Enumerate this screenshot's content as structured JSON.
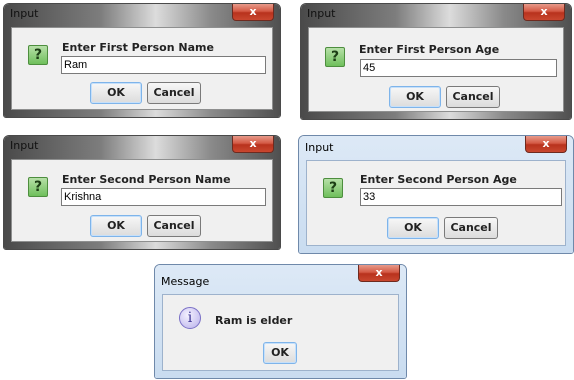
{
  "dialogs": [
    {
      "title": "Input",
      "close": "x",
      "prompt": "Enter First Person Name",
      "value": "Ram",
      "ok": "OK",
      "cancel": "Cancel"
    },
    {
      "title": "Input",
      "close": "x",
      "prompt": "Enter First Person Age",
      "value": "45",
      "ok": "OK",
      "cancel": "Cancel"
    },
    {
      "title": "Input",
      "close": "x",
      "prompt": "Enter Second Person Name",
      "value": "Krishna",
      "ok": "OK",
      "cancel": "Cancel"
    },
    {
      "title": "Input",
      "close": "x",
      "prompt": "Enter Second Person Age",
      "value": "33",
      "ok": "OK",
      "cancel": "Cancel"
    }
  ],
  "message": {
    "title": "Message",
    "close": "x",
    "text": "Ram is elder",
    "ok": "OK"
  },
  "icons": {
    "question": "?",
    "info": "i"
  }
}
